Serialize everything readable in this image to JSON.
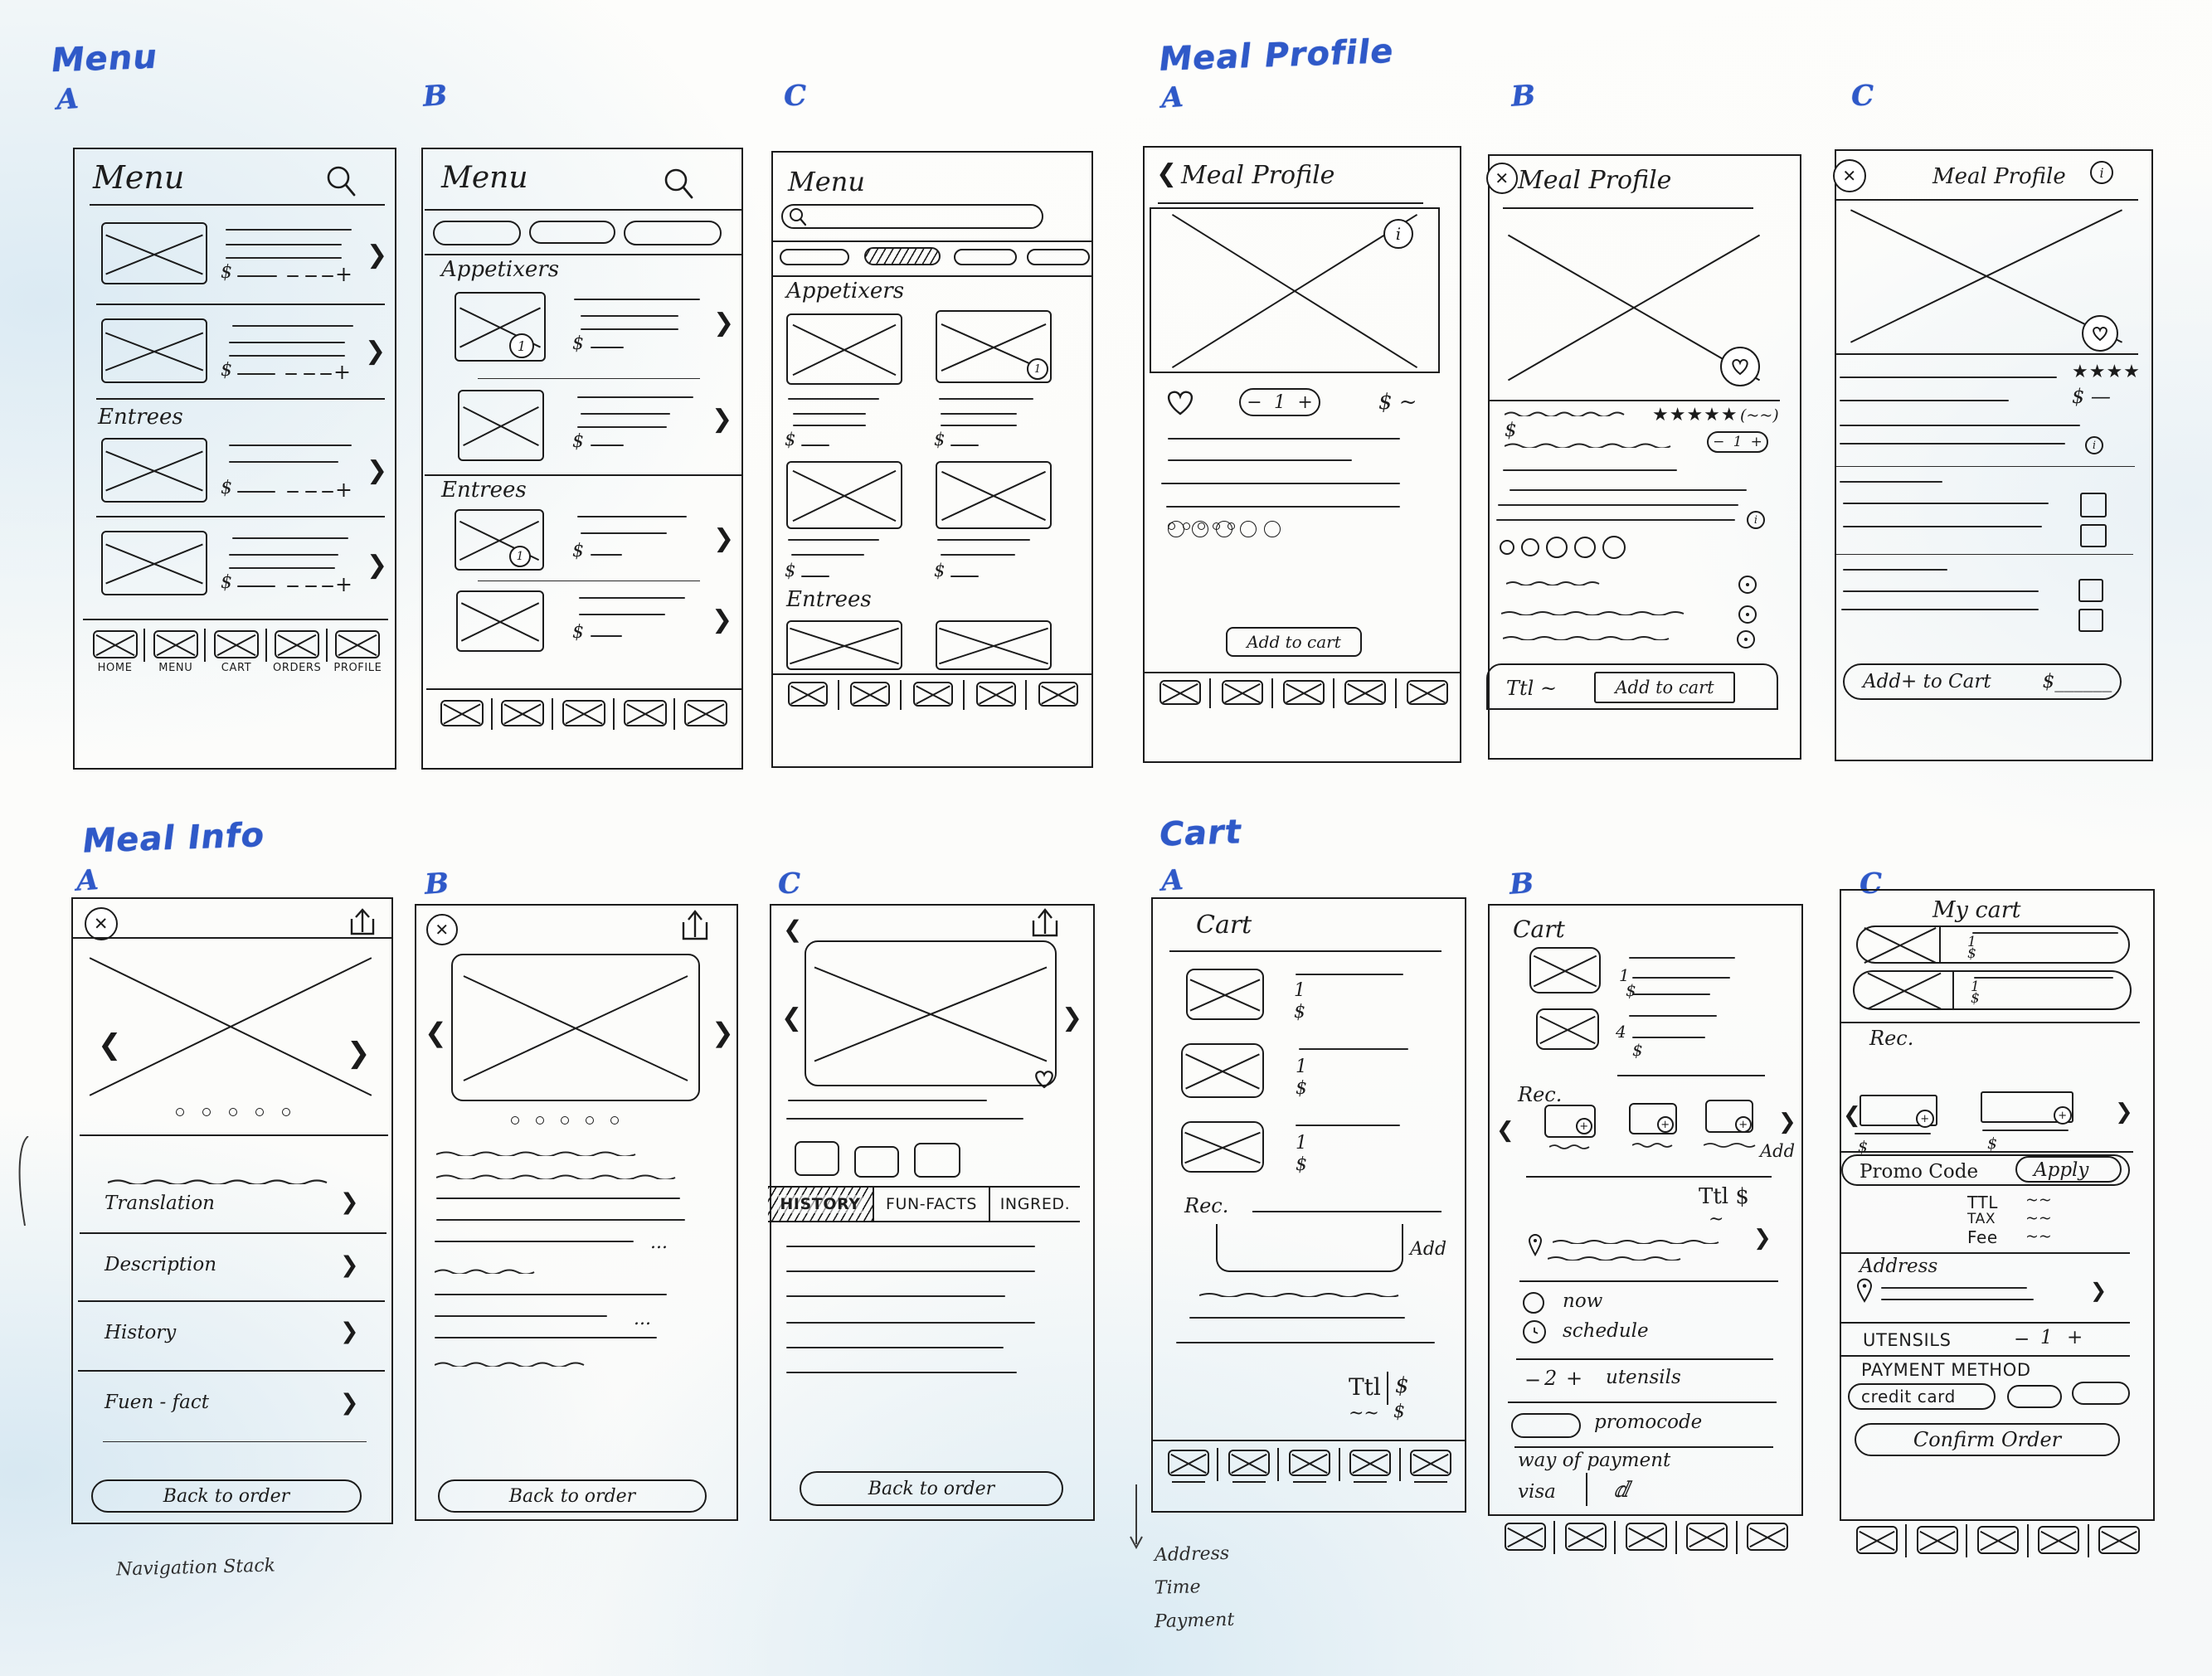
{
  "sections": [
    {
      "id": "menu",
      "title": "Menu",
      "panels": [
        "A",
        "B",
        "C"
      ]
    },
    {
      "id": "meal_profile",
      "title": "Meal Profile",
      "panels": [
        "A",
        "B",
        "C"
      ]
    },
    {
      "id": "meal_info",
      "title": "Meal Info",
      "panels": [
        "A",
        "B",
        "C"
      ]
    },
    {
      "id": "cart",
      "title": "Cart",
      "panels": [
        "A",
        "B",
        "C"
      ]
    }
  ],
  "menu": {
    "a": {
      "title": "Menu",
      "search_icon": "search-icon",
      "section_label": "Entrees",
      "price_symbol": "$",
      "stepper_plus": "+",
      "chevron": "❯",
      "tabbar": [
        {
          "label": "HOME",
          "icon": "home-icon"
        },
        {
          "label": "MENU",
          "icon": "menu-icon"
        },
        {
          "label": "CART",
          "icon": "cart-icon"
        },
        {
          "label": "ORDERS",
          "icon": "orders-icon"
        },
        {
          "label": "PROFILE",
          "icon": "profile-icon"
        }
      ]
    },
    "b": {
      "title": "Menu",
      "search_icon": "search-icon",
      "filters": [
        "",
        "",
        ""
      ],
      "sections": [
        "Appetixers",
        "Entrees"
      ],
      "price_symbol": "$",
      "badge": "1",
      "chevron": "❯"
    },
    "c": {
      "title": "Menu",
      "search_placeholder": "",
      "search_icon": "search-icon",
      "filters": [
        "",
        "",
        "",
        ""
      ],
      "active_filter_index": 1,
      "sections": [
        "Appetixers",
        "Entrees"
      ],
      "price_symbol": "$",
      "badge": "1"
    }
  },
  "meal_profile": {
    "a": {
      "back_icon": "chevron-left-icon",
      "title": "Meal Profile",
      "info_badge": "i",
      "favorite_icon": "heart-icon",
      "qty_minus": "−",
      "qty_value": "1",
      "qty_plus": "+",
      "price": "$ ~",
      "option_circles": 5,
      "cta": "Add to cart"
    },
    "b": {
      "close_icon": "x-close-icon",
      "title": "Meal Profile",
      "favorite_icon": "heart-icon",
      "rating": "★★★★★",
      "rating_count": "(~~)",
      "price_symbol": "$",
      "qty_minus": "−",
      "qty_value": "1",
      "qty_plus": "+",
      "info_badge": "i",
      "option_circles": 5,
      "radio_rows": 3,
      "total_label": "Ttl ~",
      "cta": "Add to cart"
    },
    "c": {
      "close_icon": "x-close-icon",
      "title": "Meal Profile",
      "info_badge": "i",
      "favorite_icon": "heart-icon",
      "rating": "★★★★",
      "price": "$ —",
      "checkbox_rows": 4,
      "cta": "Add+ to Cart",
      "cta_price": "$______"
    }
  },
  "meal_info": {
    "a": {
      "close_icon": "x-close-icon",
      "share_icon": "share-icon",
      "prev_icon": "chevron-left-icon",
      "next_icon": "chevron-right-icon",
      "dots": 5,
      "accordions": [
        "Translation",
        "Description",
        "History",
        "Fuen - fact"
      ],
      "accordion_icon": "chevron-down-icon",
      "cta": "Back to order"
    },
    "b": {
      "close_icon": "x-close-icon",
      "share_icon": "share-icon",
      "prev_icon": "chevron-left-icon",
      "next_icon": "chevron-right-icon",
      "dots": 5,
      "ellipsis": "...",
      "cta": "Back to order"
    },
    "c": {
      "back_icon": "chevron-left-icon",
      "share_icon": "share-icon",
      "prev_icon": "chevron-left-icon",
      "next_icon": "chevron-right-icon",
      "favorite_icon": "heart-icon",
      "thumbs": 3,
      "tabs": [
        "HISTORY",
        "FUN-FACTS",
        "INGRED."
      ],
      "active_tab_index": 0,
      "cta": "Back to order"
    },
    "caption": "Navigation Stack"
  },
  "cart": {
    "a": {
      "title": "Cart",
      "items": [
        {
          "qty": "1",
          "price": "$"
        },
        {
          "qty": "1",
          "price": "$"
        },
        {
          "qty": "1",
          "price": "$"
        }
      ],
      "rec_label": "Rec.",
      "add_label": "Add",
      "total_label": "Ttl",
      "total_price": "$",
      "total_sub": "~~",
      "total_sub_price": "$",
      "tabbar_count": 5,
      "notes": [
        "Address",
        "Time",
        "Payment"
      ]
    },
    "b": {
      "title": "Cart",
      "items": [
        {
          "qty": "1",
          "price": "$"
        },
        {
          "qty": "4",
          "price": "$"
        }
      ],
      "rec_label": "Rec.",
      "add_label": "Add",
      "prev_icon": "chevron-left-icon",
      "next_icon": "chevron-right-icon",
      "total_label": "Ttl $",
      "total_sub": "~",
      "address_icon": "location-pin-icon",
      "delivery_options": [
        {
          "label": "now",
          "icon": "radio-icon",
          "selected": false
        },
        {
          "label": "schedule",
          "icon": "clock-icon",
          "selected": true
        }
      ],
      "utensils": {
        "minus": "−",
        "value": "2",
        "plus": "+",
        "label": "utensils"
      },
      "promocode": "promocode",
      "payment_label": "way of payment",
      "payment_methods": [
        "visa",
        ""
      ],
      "tabbar_count": 5
    },
    "c": {
      "title": "My cart",
      "items": [
        {
          "qty": "1",
          "price": "$"
        },
        {
          "qty": "1",
          "price": "$"
        }
      ],
      "rec_label": "Rec.",
      "rec_prices": [
        "$",
        "$"
      ],
      "prev_icon": "chevron-left-icon",
      "next_icon": "chevron-right-icon",
      "promo_placeholder": "Promo Code",
      "apply_label": "Apply",
      "totals": [
        {
          "label": "TTL",
          "value": "~~"
        },
        {
          "label": "TAX",
          "value": "~~"
        },
        {
          "label": "Fee",
          "value": "~~"
        }
      ],
      "address_label": "Address",
      "address_icon": "location-pin-icon",
      "address_chevron": "❯",
      "utensils": {
        "label": "UTENSILS",
        "minus": "−",
        "value": "1",
        "plus": "+"
      },
      "payment_label": "PAYMENT METHOD",
      "payment_selected": "credit card",
      "payment_others": 2,
      "cta": "Confirm Order",
      "tabbar_count": 5
    }
  }
}
